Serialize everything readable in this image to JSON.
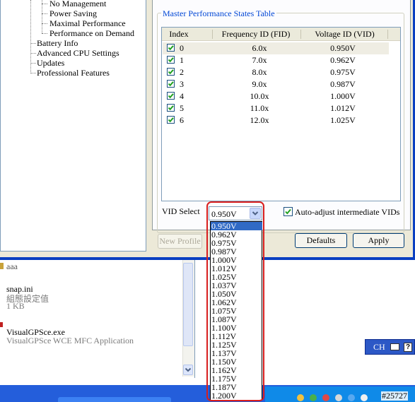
{
  "tree": {
    "items": [
      {
        "label": "No Management"
      },
      {
        "label": "Power Saving"
      },
      {
        "label": "Maximal Performance"
      },
      {
        "label": "Performance on Demand"
      },
      {
        "label": "Battery Info"
      },
      {
        "label": "Advanced CPU Settings"
      },
      {
        "label": "Updates"
      },
      {
        "label": "Professional Features"
      }
    ]
  },
  "group": {
    "title": "Master Performance States Table"
  },
  "table": {
    "columns": [
      "Index",
      "Frequency ID (FID)",
      "Voltage ID (VID)"
    ],
    "rows": [
      {
        "index": "0",
        "fid": "6.0x",
        "vid": "0.950V",
        "checked": true
      },
      {
        "index": "1",
        "fid": "7.0x",
        "vid": "0.962V",
        "checked": true
      },
      {
        "index": "2",
        "fid": "8.0x",
        "vid": "0.975V",
        "checked": true
      },
      {
        "index": "3",
        "fid": "9.0x",
        "vid": "0.987V",
        "checked": true
      },
      {
        "index": "4",
        "fid": "10.0x",
        "vid": "1.000V",
        "checked": true
      },
      {
        "index": "5",
        "fid": "11.0x",
        "vid": "1.012V",
        "checked": true
      },
      {
        "index": "6",
        "fid": "12.0x",
        "vid": "1.025V",
        "checked": true
      }
    ]
  },
  "vid_select": {
    "label": "VID Select",
    "value": "0.950V",
    "options": [
      "0.950V",
      "0.962V",
      "0.975V",
      "0.987V",
      "1.000V",
      "1.012V",
      "1.025V",
      "1.037V",
      "1.050V",
      "1.062V",
      "1.075V",
      "1.087V",
      "1.100V",
      "1.112V",
      "1.125V",
      "1.137V",
      "1.150V",
      "1.162V",
      "1.175V",
      "1.187V",
      "1.200V"
    ]
  },
  "auto_adjust": {
    "label": "Auto-adjust intermediate VIDs",
    "checked": true
  },
  "buttons": {
    "new_profile": "New Profile",
    "defaults": "Defaults",
    "apply": "Apply"
  },
  "explorer": {
    "files": [
      {
        "name": "aaa",
        "line2": ""
      },
      {
        "name": "snap.ini",
        "line2": "組態設定值",
        "line3": "1 KB"
      },
      {
        "name": "VisualGPSce.exe",
        "line2": "VisualGPSce WCE MFC Application"
      }
    ]
  },
  "langbar": {
    "label": "CH"
  },
  "counter": "#25727",
  "colors": {
    "accent": "#0046d5",
    "selection": "#316ac5",
    "annotation": "#d81e1e"
  }
}
